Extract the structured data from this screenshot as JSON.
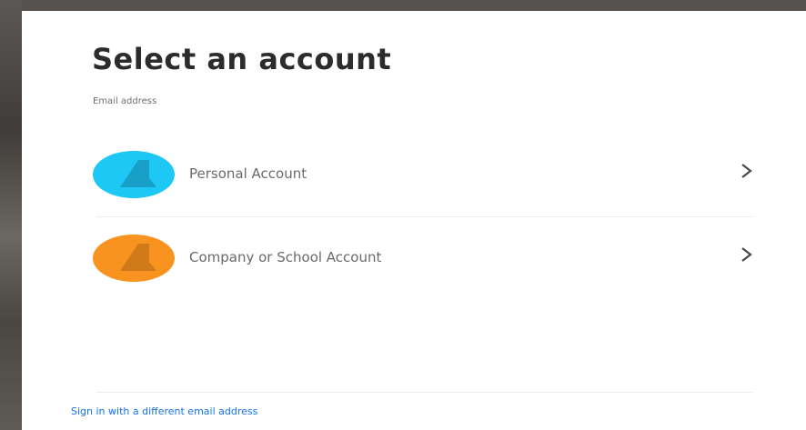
{
  "dialog": {
    "title": "Select an account",
    "email_label": "Email address"
  },
  "accounts": [
    {
      "label": "Personal Account",
      "icon": "personal-account-icon",
      "color": "#1ec8f5",
      "shade": "#1698be"
    },
    {
      "label": "Company or School Account",
      "icon": "company-account-icon",
      "color": "#f7931e",
      "shade": "#c9761a"
    }
  ],
  "footer": {
    "alt_link": "Sign in with a different email address"
  },
  "colors": {
    "link": "#1473e6",
    "title": "#2c2c2c"
  }
}
